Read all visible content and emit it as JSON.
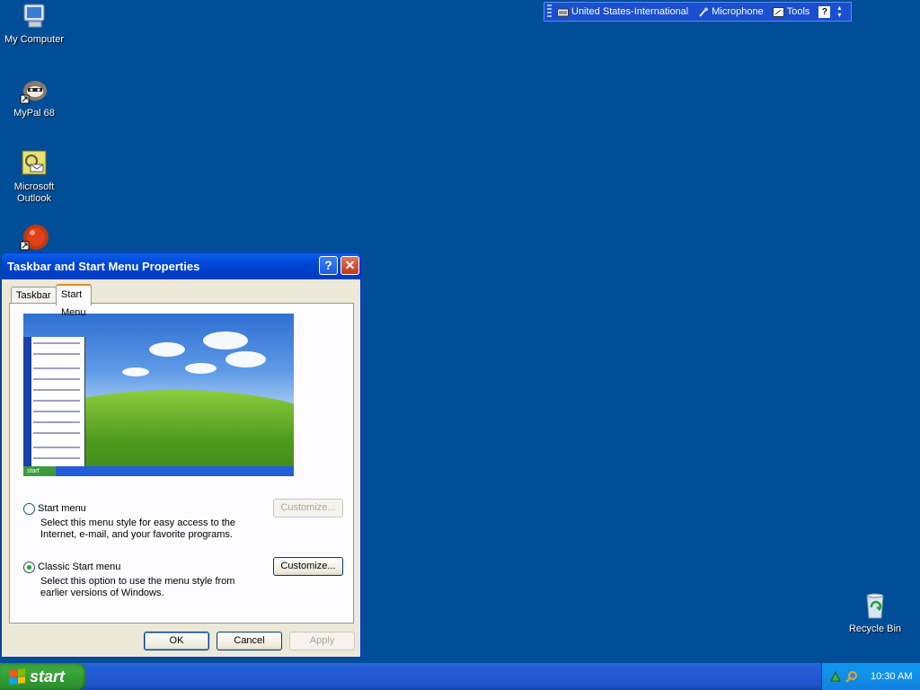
{
  "desktop": {
    "icons": [
      {
        "label": "My Computer",
        "icon": "my-computer-icon"
      },
      {
        "label": "MyPal 68",
        "icon": "mypal-icon"
      },
      {
        "label": "Microsoft Outlook",
        "icon": "outlook-icon"
      },
      {
        "label": "",
        "icon": "red-ball-shortcut-icon"
      },
      {
        "label": "Recycle Bin",
        "icon": "recycle-bin-icon"
      }
    ]
  },
  "language_bar": {
    "language": "United States-International",
    "microphone": "Microphone",
    "tools": "Tools",
    "help": "?"
  },
  "dialog": {
    "title": "Taskbar and Start Menu Properties",
    "help_button": "?",
    "close_button": "✕",
    "tabs": [
      {
        "label": "Taskbar",
        "active": false
      },
      {
        "label": "Start Menu",
        "active": true
      }
    ],
    "preview": {
      "start_label": "start"
    },
    "option_start_menu": {
      "label": "Start menu",
      "description": "Select this menu style for easy access to the Internet, e-mail, and your favorite programs.",
      "checked": false,
      "customize": "Customize...",
      "customize_enabled": false
    },
    "option_classic": {
      "label": "Classic Start menu",
      "description": "Select this option to use the menu style from earlier versions of Windows.",
      "checked": true,
      "customize": "Customize...",
      "customize_enabled": true
    },
    "ok": "OK",
    "cancel": "Cancel",
    "apply": "Apply"
  },
  "taskbar": {
    "start_label": "start",
    "clock": "10:30 AM"
  },
  "colors": {
    "desktop": "#004e98",
    "title_bar": "#0046d5",
    "taskbar": "#245edb",
    "start_button": "#39a83a",
    "tray": "#1290e8"
  }
}
